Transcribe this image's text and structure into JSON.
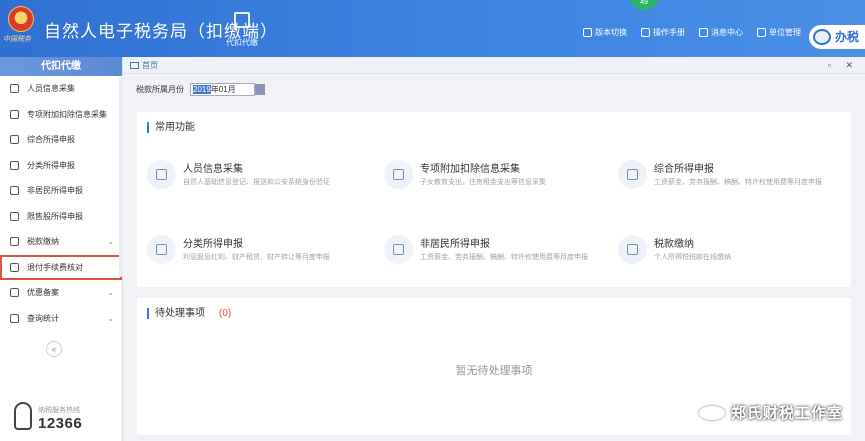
{
  "header": {
    "emblem_text": "中国税务",
    "app_title": "自然人电子税务局（扣缴端）",
    "nav_main": "代扣代缴",
    "badge": "49",
    "tools": [
      "版本切换",
      "操作手册",
      "消息中心",
      "单位管理"
    ],
    "hall_label": "办税"
  },
  "sidebar": {
    "header": "代扣代缴",
    "items": [
      {
        "label": "人员信息采集"
      },
      {
        "label": "专项附加扣除信息采集"
      },
      {
        "label": "综合所得申报"
      },
      {
        "label": "分类所得申报"
      },
      {
        "label": "非居民所得申报"
      },
      {
        "label": "限售股所得申报"
      },
      {
        "label": "税款缴纳"
      },
      {
        "label": "退付手续费核对"
      },
      {
        "label": "优惠备案"
      },
      {
        "label": "查询统计"
      }
    ],
    "collapse": "«",
    "hotline_label": "纳税服务热线",
    "hotline_number": "12366"
  },
  "tabs": {
    "home": "首页",
    "win_btns": "▫ ✕"
  },
  "period": {
    "label": "税款所属月份",
    "year": "2019",
    "rest": "年01月"
  },
  "common": {
    "title": "常用功能",
    "cards": [
      {
        "title": "人员信息采集",
        "desc": "自然人基础信息登记、报送和公安系统身份验证"
      },
      {
        "title": "专项附加扣除信息采集",
        "desc": "子女教育支出，住房租金支出等信息采集"
      },
      {
        "title": "综合所得申报",
        "desc": "工资薪金、劳务报酬、稿酬、特许权使用费等月度申报"
      },
      {
        "title": "分类所得申报",
        "desc": "利息股息红利、财产租赁、财产转让等月度申报"
      },
      {
        "title": "非居民所得申报",
        "desc": "工资薪金、劳务报酬、稿酬、特许权使用费等月度申报"
      },
      {
        "title": "税款缴纳",
        "desc": "个人所得税税款在线缴纳"
      }
    ]
  },
  "pending": {
    "title": "待处理事项",
    "count": "(0)",
    "empty": "暂无待处理事项"
  },
  "watermark": "郑氏财税工作室"
}
